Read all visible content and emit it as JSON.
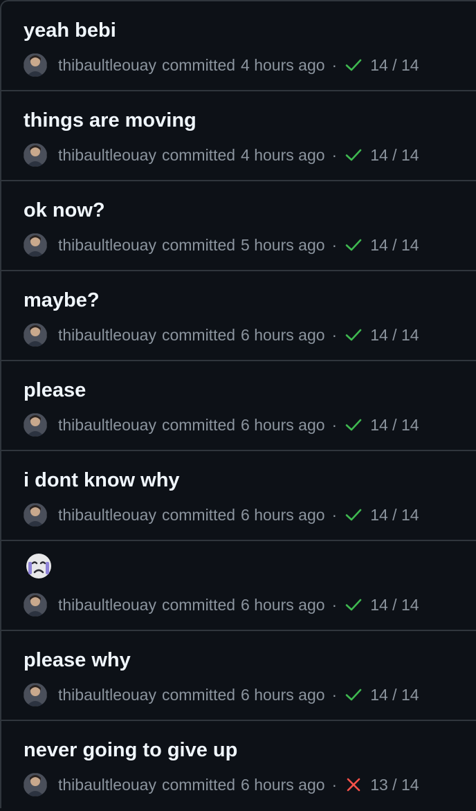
{
  "colors": {
    "background": "#0d1117",
    "border": "#30363d",
    "title": "#f0f6fc",
    "muted": "#8b949e",
    "success": "#3fb950",
    "failure": "#f85149"
  },
  "commits": [
    {
      "title": "yeah bebi",
      "author": "thibaultleouay",
      "verb": "committed",
      "time": "4 hours ago",
      "separator": "·",
      "status": "success",
      "status_icon": "check-icon",
      "checks": "14 / 14"
    },
    {
      "title": "things are moving",
      "author": "thibaultleouay",
      "verb": "committed",
      "time": "4 hours ago",
      "separator": "·",
      "status": "success",
      "status_icon": "check-icon",
      "checks": "14 / 14"
    },
    {
      "title": "ok now?",
      "author": "thibaultleouay",
      "verb": "committed",
      "time": "5 hours ago",
      "separator": "·",
      "status": "success",
      "status_icon": "check-icon",
      "checks": "14 / 14"
    },
    {
      "title": "maybe?",
      "author": "thibaultleouay",
      "verb": "committed",
      "time": "6 hours ago",
      "separator": "·",
      "status": "success",
      "status_icon": "check-icon",
      "checks": "14 / 14"
    },
    {
      "title": "please",
      "author": "thibaultleouay",
      "verb": "committed",
      "time": "6 hours ago",
      "separator": "·",
      "status": "success",
      "status_icon": "check-icon",
      "checks": "14 / 14"
    },
    {
      "title": "i dont know why",
      "author": "thibaultleouay",
      "verb": "committed",
      "time": "6 hours ago",
      "separator": "·",
      "status": "success",
      "status_icon": "check-icon",
      "checks": "14 / 14"
    },
    {
      "title": "",
      "title_icon": "crying-face-emoji-icon",
      "author": "thibaultleouay",
      "verb": "committed",
      "time": "6 hours ago",
      "separator": "·",
      "status": "success",
      "status_icon": "check-icon",
      "checks": "14 / 14"
    },
    {
      "title": "please why",
      "author": "thibaultleouay",
      "verb": "committed",
      "time": "6 hours ago",
      "separator": "·",
      "status": "success",
      "status_icon": "check-icon",
      "checks": "14 / 14"
    },
    {
      "title": "never going to give up",
      "author": "thibaultleouay",
      "verb": "committed",
      "time": "6 hours ago",
      "separator": "·",
      "status": "failure",
      "status_icon": "x-icon",
      "checks": "13 / 14"
    }
  ]
}
